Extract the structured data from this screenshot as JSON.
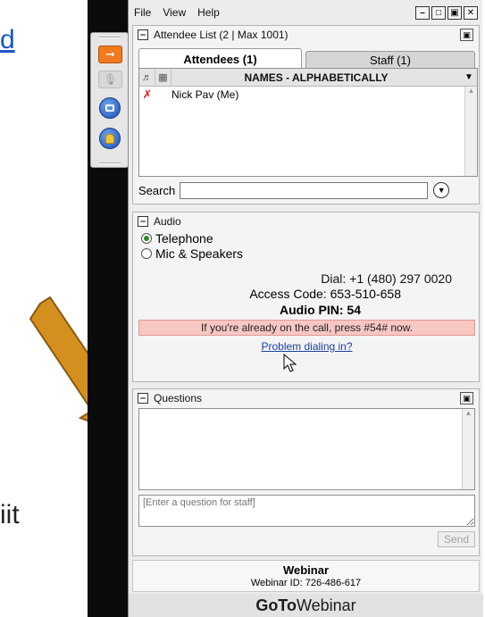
{
  "slide": {
    "link_fragment": "d",
    "text_fragment": "iit"
  },
  "menu": {
    "file": "File",
    "view": "View",
    "help": "Help"
  },
  "window_buttons": [
    "minimize",
    "restore",
    "popout",
    "close"
  ],
  "grab_tab": {
    "icons": [
      "arrow-icon",
      "mic-icon",
      "screen-icon",
      "raise-hand-icon"
    ]
  },
  "attendee_list": {
    "title": "Attendee List",
    "count_text": "(2 | Max 1001)",
    "tabs": {
      "attendees": "Attendees (1)",
      "staff": "Staff (1)"
    },
    "column_header": "NAMES - ALPHABETICALLY",
    "rows": [
      {
        "name": "Nick Pav (Me)",
        "muted": true
      }
    ],
    "search_label": "Search",
    "search_value": ""
  },
  "audio": {
    "title": "Audio",
    "options": [
      {
        "label": "Telephone",
        "selected": true
      },
      {
        "label": "Mic & Speakers",
        "selected": false
      }
    ],
    "dial_label": "Dial:",
    "dial_number": "+1 (480) 297 0020",
    "access_label": "Access Code:",
    "access_code": "653-510-658",
    "pin_label": "Audio PIN:",
    "pin": "54",
    "alert": "If you're already on the call, press #54# now.",
    "problem_link": "Problem dialing in?"
  },
  "questions": {
    "title": "Questions",
    "input_placeholder": "[Enter a question for staff]",
    "send_label": "Send"
  },
  "footer": {
    "title": "Webinar",
    "webinar_id_label": "Webinar ID:",
    "webinar_id": "726-486-617",
    "brand_bold": "GoTo",
    "brand_rest": "Webinar"
  },
  "colors": {
    "arrow": "#d4901f",
    "alert_bg": "#f7c7c4",
    "link": "#1a3fa0",
    "orange_button": "#f07a1d"
  }
}
